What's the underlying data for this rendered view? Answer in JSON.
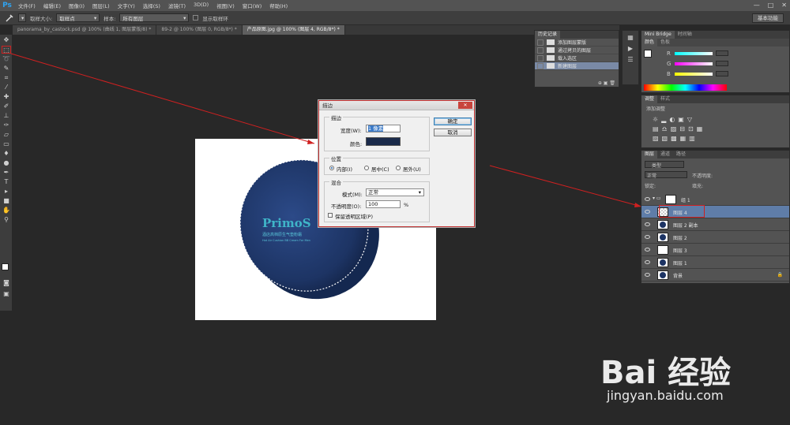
{
  "app": {
    "logo": "Ps",
    "menu": [
      "文件(F)",
      "编辑(E)",
      "图像(I)",
      "图层(L)",
      "文字(Y)",
      "选择(S)",
      "滤镜(T)",
      "3D(D)",
      "视图(V)",
      "窗口(W)",
      "帮助(H)"
    ],
    "window_controls": [
      "—",
      "□",
      "✕"
    ]
  },
  "options": {
    "sample_size_label": "取样大小:",
    "sample_size_value": "取样点",
    "sample_label": "样本:",
    "sample_value": "所有图层",
    "show_ring_label": "显示取样环",
    "workspace": "基本功能"
  },
  "tabs": [
    {
      "label": "panorama_by_castock.psd @ 100% (曲线 1, 图层蒙版/8) *",
      "active": false
    },
    {
      "label": "89-2 @ 100% (图层 0, RGB/8*) *",
      "active": false
    },
    {
      "label": "产品原图.jpg @ 100% (图层 4, RGB/8*) *",
      "active": true
    }
  ],
  "tools": [
    "move",
    "marquee",
    "lasso",
    "quick-select",
    "crop",
    "eyedropper",
    "healing",
    "brush",
    "stamp",
    "history-brush",
    "eraser",
    "gradient",
    "blur",
    "dodge",
    "pen",
    "type",
    "path-select",
    "shape",
    "hand",
    "zoom"
  ],
  "product": {
    "brand_text": "PrimoS",
    "line1": "酒店高档原生气垫粉霜",
    "line2": "Hot Air Cushion BB Cream For Men",
    "color": "#1d3464"
  },
  "dialog": {
    "title": "描边",
    "close": "✕",
    "stroke_group": "描边",
    "width_label": "宽度(W):",
    "width_value": "1 像素",
    "color_label": "颜色:",
    "stroke_color": "#1a2a4a",
    "position_group": "位置",
    "pos_inside": "内部(I)",
    "pos_center": "居中(C)",
    "pos_outside": "居外(U)",
    "blend_group": "混合",
    "mode_label": "模式(M):",
    "mode_value": "正常",
    "opacity_label": "不透明度(O):",
    "opacity_value": "100",
    "opacity_unit": "%",
    "preserve_label": "保留透明区域(P)",
    "ok": "确定",
    "cancel": "取消"
  },
  "history": {
    "tab": "历史记录",
    "items": [
      "添加图层蒙版",
      "通过拷贝的图层",
      "载入选区",
      "新建图层"
    ],
    "selected_index": 3
  },
  "color_panel": {
    "tabs": [
      "Mini Bridge",
      "时间轴"
    ],
    "subtabs": [
      "颜色",
      "色板"
    ],
    "channels": [
      "R",
      "G",
      "B"
    ],
    "fg_color": "#ffffff",
    "bg_color": "#f0a020"
  },
  "adjust_panel": {
    "tabs": [
      "调整",
      "样式"
    ],
    "hint": "添加调整"
  },
  "layers_panel": {
    "tabs": [
      "图层",
      "通道",
      "路径"
    ],
    "kind_label": "类型",
    "blend_mode": "正常",
    "opacity_label": "不透明度:",
    "lock_label": "锁定:",
    "fill_label": "填充:",
    "layers": [
      {
        "name": "组 1",
        "type": "group",
        "selected": false
      },
      {
        "name": "图层 4",
        "type": "empty",
        "selected": true
      },
      {
        "name": "图层 2 副本",
        "type": "round",
        "selected": false
      },
      {
        "name": "图层 2",
        "type": "round",
        "selected": false
      },
      {
        "name": "图层 3",
        "type": "white",
        "selected": false
      },
      {
        "name": "图层 1",
        "type": "round",
        "selected": false
      },
      {
        "name": "背景",
        "type": "round",
        "selected": false
      }
    ]
  },
  "watermark": {
    "brand": "Bai 经验",
    "url": "jingyan.baidu.com"
  }
}
